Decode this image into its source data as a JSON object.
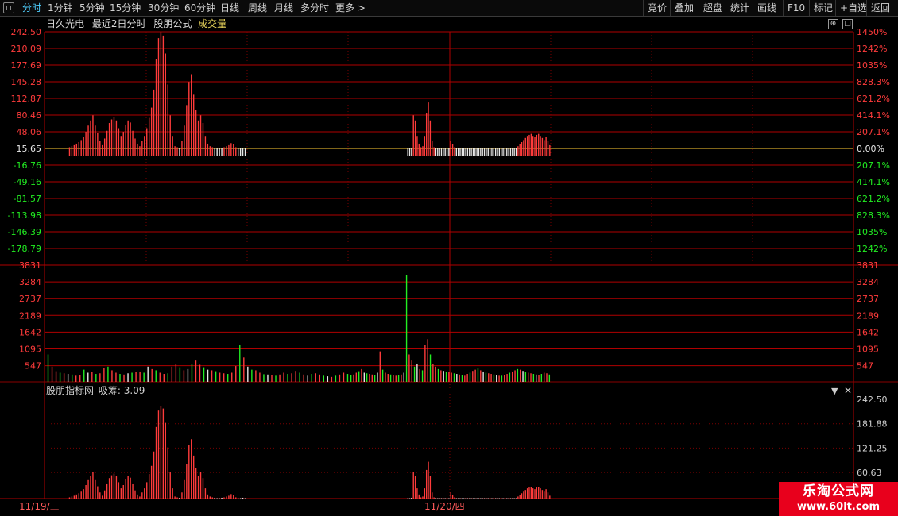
{
  "toolbar": {
    "left_tabs": [
      "分时",
      "1分钟",
      "5分钟",
      "15分钟",
      "30分钟",
      "60分钟",
      "日线",
      "周线",
      "月线",
      "多分时",
      "更多 >"
    ],
    "active_tab": "分时",
    "right_buttons": [
      "竞价",
      "叠加",
      "超盘",
      "统计",
      "画线",
      "F10",
      "标记",
      "+自选",
      "返回"
    ]
  },
  "header": {
    "stock_name": "日久光电",
    "period": "最近2日分时",
    "indicator": "股朋公式",
    "volume_label": "成交量"
  },
  "price_axis": {
    "left_labels": [
      "242.50",
      "210.09",
      "177.69",
      "145.28",
      "112.87",
      "80.46",
      "48.06",
      "15.65",
      "-16.76",
      "-49.16",
      "-81.57",
      "-113.98",
      "-146.39",
      "-178.79"
    ],
    "right_labels": [
      "1450%",
      "1242%",
      "1035%",
      "828.3%",
      "621.2%",
      "414.1%",
      "207.1%",
      "0.00%",
      "207.1%",
      "414.1%",
      "621.2%",
      "828.3%",
      "1035%",
      "1242%"
    ],
    "baseline": "15.65"
  },
  "volume_axis": {
    "labels": [
      "3831",
      "3284",
      "2737",
      "2189",
      "1642",
      "1095",
      "547"
    ]
  },
  "indicator_panel": {
    "title": "股朋指标网",
    "series_label": "吸筹",
    "series_value": "3.09",
    "right_labels": [
      "242.50",
      "181.88",
      "121.25",
      "60.63"
    ]
  },
  "dates": [
    "11/19/三",
    "11/20/四"
  ],
  "watermark": {
    "line1": "乐淘公式网",
    "line2": "www.60lt.com"
  },
  "colors": {
    "up": "#ff3b3b",
    "down": "#22ee22",
    "grid": "#b00000",
    "baseline": "#ffcc33",
    "neutral": "#e8e8e8"
  },
  "chart_data": {
    "type": "bar",
    "title": "",
    "xlabel": "",
    "ylabel": "",
    "day1_label": "11/19/三",
    "day2_label": "11/20/四",
    "price_panel_series": {
      "name": "吸筹",
      "ylim": [
        -178.79,
        242.5
      ],
      "baseline": 15.65,
      "day1_values": [
        18,
        20,
        22,
        25,
        28,
        32,
        38,
        48,
        60,
        70,
        80,
        60,
        45,
        30,
        22,
        35,
        50,
        65,
        72,
        76,
        70,
        55,
        40,
        48,
        62,
        70,
        66,
        50,
        35,
        25,
        20,
        30,
        40,
        55,
        75,
        95,
        130,
        190,
        230,
        242,
        235,
        200,
        140,
        80,
        40,
        20,
        18,
        17,
        30,
        60,
        100,
        145,
        160,
        120,
        90,
        70,
        80,
        65,
        40,
        25,
        20,
        18,
        17,
        16,
        16,
        17,
        18,
        20,
        22,
        26,
        24,
        18,
        16,
        16,
        17,
        16
      ],
      "day2_values": [
        16,
        16,
        17,
        80,
        70,
        40,
        25,
        18,
        20,
        40,
        85,
        105,
        70,
        30,
        18,
        16,
        16,
        16,
        16,
        16,
        16,
        16,
        16,
        30,
        24,
        18,
        16,
        16,
        16,
        16,
        16,
        16,
        16,
        16,
        16,
        16,
        16,
        16,
        16,
        16,
        16,
        16,
        16,
        16,
        16,
        16,
        16,
        16,
        16,
        16,
        16,
        16,
        16,
        16,
        16,
        16,
        16,
        16,
        16,
        20,
        24,
        28,
        32,
        36,
        40,
        42,
        44,
        40,
        38,
        42,
        44,
        40,
        36,
        32,
        38,
        30,
        22
      ]
    },
    "volume_panel_series": {
      "ylim": [
        0,
        3831
      ],
      "day1_values": [
        900,
        500,
        350,
        300,
        280,
        260,
        240,
        200,
        220,
        400,
        300,
        320,
        260,
        280,
        450,
        500,
        380,
        300,
        260,
        240,
        280,
        300,
        320,
        340,
        300,
        500,
        420,
        380,
        300,
        260,
        280,
        500,
        600,
        480,
        380,
        420,
        600,
        700,
        560,
        480,
        400,
        380,
        350,
        300,
        280,
        260,
        300,
        520,
        1200,
        800,
        500,
        400,
        380,
        300,
        250,
        240,
        220,
        200,
        240,
        300,
        260,
        280,
        360,
        300,
        240,
        200,
        260,
        280,
        240,
        200,
        180,
        160,
        200,
        240,
        300,
        260
      ],
      "day2_values": [
        220,
        240,
        300,
        350,
        420,
        300,
        280,
        260,
        240,
        220,
        300,
        1000,
        400,
        300,
        260,
        240,
        220,
        200,
        220,
        240,
        300,
        3500,
        900,
        700,
        500,
        600,
        420,
        380,
        1200,
        1400,
        900,
        600,
        500,
        420,
        380,
        360,
        340,
        320,
        300,
        280,
        260,
        240,
        220,
        200,
        260,
        300,
        360,
        400,
        440,
        380,
        340,
        300,
        280,
        260,
        240,
        220,
        200,
        200,
        220,
        260,
        300,
        340,
        380,
        420,
        400,
        360,
        320,
        300,
        280,
        260,
        240,
        220,
        260,
        300,
        280,
        240
      ]
    },
    "indicator_series": {
      "name": "吸筹",
      "ylim": [
        0,
        242.5
      ]
    }
  }
}
